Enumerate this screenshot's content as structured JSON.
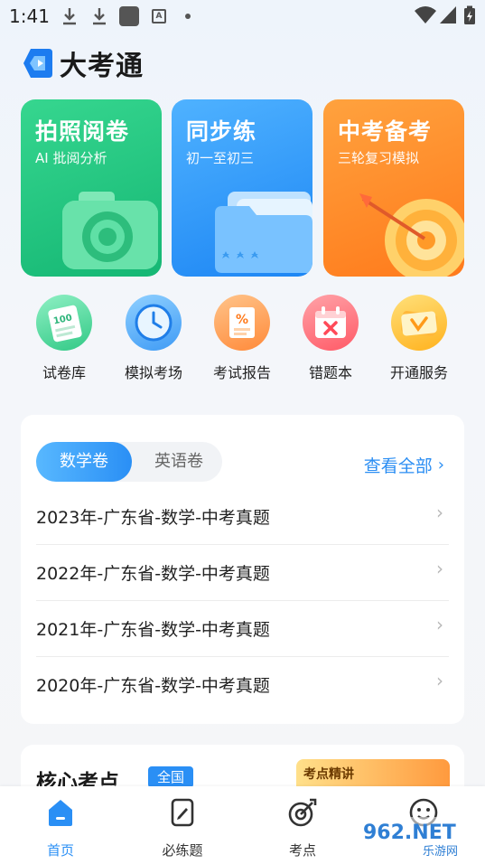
{
  "status_bar": {
    "time": "1:41",
    "icons": [
      "download-icon",
      "download-icon",
      "app-square-icon",
      "a-badge-icon",
      "dot-icon",
      "wifi-icon",
      "battery-charging-icon"
    ]
  },
  "app": {
    "title": "大考通",
    "logo_icon": "daokaotong-logo-icon"
  },
  "feature_cards": [
    {
      "title": "拍照阅卷",
      "subtitle": "AI 批阅分析",
      "icon": "camera-icon",
      "color": "#1fc37f"
    },
    {
      "title": "同步练",
      "subtitle": "初一至初三",
      "icon": "folder-icon",
      "color": "#2f97fa"
    },
    {
      "title": "中考备考",
      "subtitle": "三轮复习模拟",
      "icon": "target-icon",
      "color": "#ff8a2a"
    }
  ],
  "shortcuts": [
    {
      "label": "试卷库",
      "icon": "paper-100-icon"
    },
    {
      "label": "模拟考场",
      "icon": "clock-icon"
    },
    {
      "label": "考试报告",
      "icon": "report-percent-icon"
    },
    {
      "label": "错题本",
      "icon": "calendar-x-icon"
    },
    {
      "label": "开通服务",
      "icon": "vip-card-icon"
    }
  ],
  "paper_panel": {
    "tabs": [
      "数学卷",
      "英语卷"
    ],
    "active_tab": "数学卷",
    "view_all": "查看全部",
    "items": [
      "2023年-广东省-数学-中考真题",
      "2022年-广东省-数学-中考真题",
      "2021年-广东省-数学-中考真题",
      "2020年-广东省-数学-中考真题"
    ]
  },
  "core_section": {
    "title": "核心考点",
    "badge": "全国",
    "promo": "考点精讲"
  },
  "bottom_nav": [
    {
      "label": "首页",
      "icon": "home-icon",
      "active": true
    },
    {
      "label": "必练题",
      "icon": "edit-doc-icon",
      "active": false
    },
    {
      "label": "考点",
      "icon": "target-pen-icon",
      "active": false
    },
    {
      "label": "",
      "icon": "smile-icon",
      "active": false
    }
  ],
  "watermark": {
    "text": "962.NET",
    "subtext": "乐游网"
  },
  "colors": {
    "accent": "#2a8ff5",
    "green": "#1fc37f",
    "orange": "#ff8a2a"
  }
}
